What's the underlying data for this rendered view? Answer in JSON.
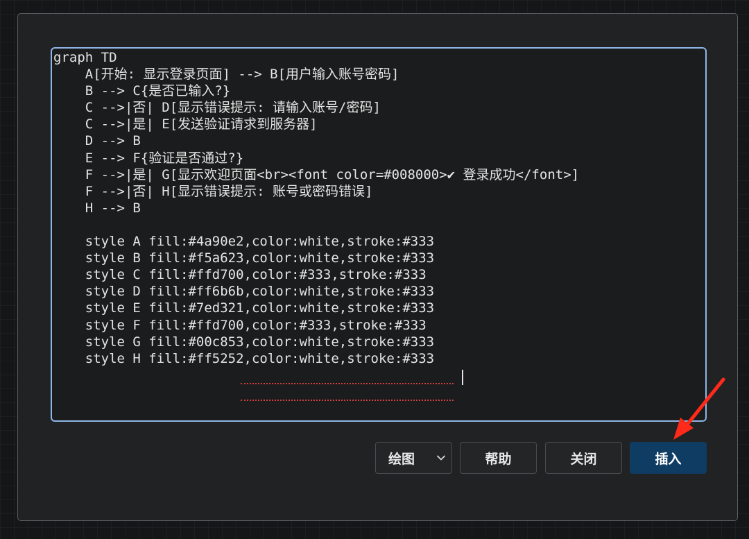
{
  "editor": {
    "code": "graph TD\n    A[开始: 显示登录页面] --> B[用户输入账号密码]\n    B --> C{是否已输入?}\n    C -->|否| D[显示错误提示: 请输入账号/密码]\n    C -->|是| E[发送验证请求到服务器]\n    D --> B\n    E --> F{验证是否通过?}\n    F -->|是| G[显示欢迎页面<br><font color=#008000>✔ 登录成功</font>]\n    F -->|否| H[显示错误提示: 账号或密码错误]\n    H --> B\n\n    style A fill:#4a90e2,color:white,stroke:#333\n    style B fill:#f5a623,color:white,stroke:#333\n    style C fill:#ffd700,color:#333,stroke:#333\n    style D fill:#ff6b6b,color:white,stroke:#333\n    style E fill:#7ed321,color:white,stroke:#333\n    style F fill:#ffd700,color:#333,stroke:#333\n    style G fill:#00c853,color:white,stroke:#333\n    style H fill:#ff5252,color:white,stroke:#333"
  },
  "buttons": {
    "mode_select": "绘图",
    "help": "帮助",
    "close": "关闭",
    "insert": "插入"
  },
  "icons": {
    "select_chevron": "chevron-down-icon",
    "annotation": "red-arrow-icon"
  },
  "colors": {
    "editor_focus_border": "#8fb7e8",
    "primary_button": "#0e3c63",
    "annotation_arrow": "#ff2a1a"
  }
}
